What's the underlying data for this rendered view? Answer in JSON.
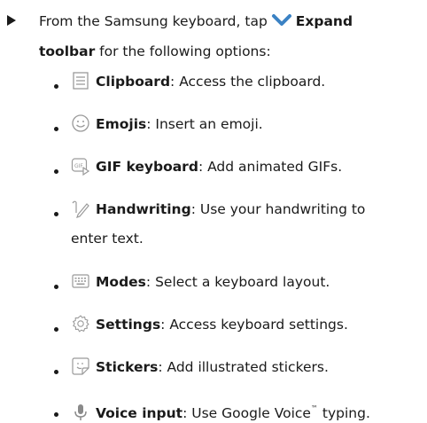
{
  "intro": {
    "text_before": "From the Samsung keyboard, tap",
    "expand_label": "Expand",
    "toolbar_label": "toolbar",
    "text_after": " for the following options:"
  },
  "items": [
    {
      "name": "Clipboard",
      "desc": ": Access the clipboard.",
      "icon": "clipboard-icon"
    },
    {
      "name": "Emojis",
      "desc": ": Insert an emoji.",
      "icon": "emoji-icon"
    },
    {
      "name": "GIF keyboard",
      "desc": ": Add animated GIFs.",
      "icon": "gif-icon"
    },
    {
      "name": "Handwriting",
      "desc": ": Use your handwriting to",
      "desc2": "enter text.",
      "icon": "handwriting-icon"
    },
    {
      "name": "Modes",
      "desc": ": Select a keyboard layout.",
      "icon": "keyboard-icon"
    },
    {
      "name": "Settings",
      "desc": ": Access keyboard settings.",
      "icon": "gear-icon"
    },
    {
      "name": "Stickers",
      "desc": ": Add illustrated stickers.",
      "icon": "sticker-icon"
    },
    {
      "name": "Voice input",
      "desc": ": Use Google Voice",
      "tm": "™",
      "desc_tail": " typing.",
      "icon": "microphone-icon"
    }
  ],
  "colors": {
    "text": "#1a1a1a",
    "icon": "#9a9a9a",
    "chevron": "#3b82c4"
  }
}
